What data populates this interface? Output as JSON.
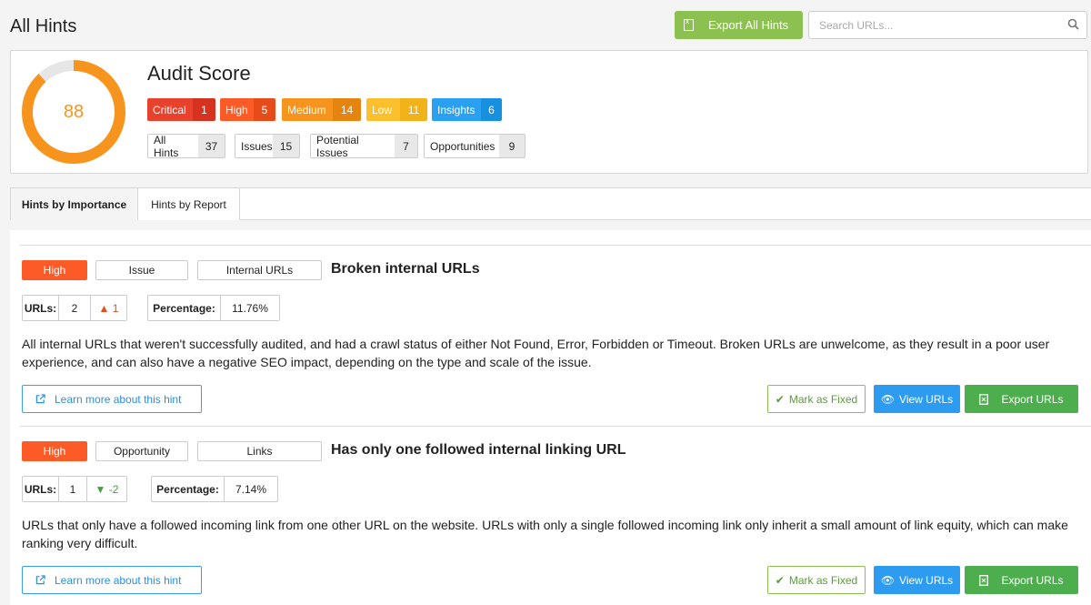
{
  "page": {
    "title": "All Hints"
  },
  "toolbar": {
    "export_label": "Export All Hints",
    "search_placeholder": "Search URLs..."
  },
  "score": {
    "value": "88",
    "fraction": 0.88,
    "title": "Audit Score",
    "severities": [
      {
        "label": "Critical",
        "count": "1",
        "color": "#e8412c",
        "count_color": "#d63220"
      },
      {
        "label": "High",
        "count": "5",
        "color": "#fc5a26",
        "count_color": "#e84b1a"
      },
      {
        "label": "Medium",
        "count": "14",
        "color": "#f7941e",
        "count_color": "#e5840e"
      },
      {
        "label": "Low",
        "count": "11",
        "color": "#fcc02c",
        "count_color": "#f2b31a"
      },
      {
        "label": "Insights",
        "count": "6",
        "color": "#2aa1f0",
        "count_color": "#1890e0"
      }
    ],
    "categories": [
      {
        "label": "All Hints",
        "count": "37"
      },
      {
        "label": "Issues",
        "count": "15"
      },
      {
        "label": "Potential Issues",
        "count": "7"
      },
      {
        "label": "Opportunities",
        "count": "9"
      }
    ]
  },
  "tabs": [
    {
      "label": "Hints by Importance",
      "active": true
    },
    {
      "label": "Hints by Report",
      "active": false
    }
  ],
  "hints": [
    {
      "priority": "High",
      "type": "Issue",
      "section": "Internal URLs",
      "title": "Broken internal URLs",
      "urls_label": "URLs:",
      "urls": "2",
      "trend": "▲ 1",
      "trend_dir": "up",
      "pct_label": "Percentage:",
      "pct": "11.76%",
      "description": "All internal URLs that weren't successfully audited, and had a crawl status of either Not Found, Error, Forbidden or Timeout. Broken URLs are unwelcome, as they result in a poor user experience, and can also have a negative SEO impact, depending on the type and scale of the issue.",
      "learn_label": "Learn more about this hint",
      "fixed_label": "Mark as Fixed",
      "view_label": "View URLs",
      "export_label": "Export URLs"
    },
    {
      "priority": "High",
      "type": "Opportunity",
      "section": "Links",
      "title": "Has only one followed internal linking URL",
      "urls_label": "URLs:",
      "urls": "1",
      "trend": "▼ -2",
      "trend_dir": "down",
      "pct_label": "Percentage:",
      "pct": "7.14%",
      "description": "URLs that only have a followed incoming link from one other URL on the website. URLs with only a single followed incoming link only inherit a small amount of link equity, which can make ranking very difficult.",
      "learn_label": "Learn more about this hint",
      "fixed_label": "Mark as Fixed",
      "view_label": "View URLs",
      "export_label": "Export URLs"
    }
  ],
  "colors": {
    "accent_green": "#8cc152",
    "gauge": "#f7941e",
    "gauge_track": "#e6e6e6"
  },
  "icons": {
    "export": "excel-file-icon",
    "search": "search-icon",
    "external": "external-link-icon",
    "check": "check-icon",
    "eye": "eye-icon"
  }
}
